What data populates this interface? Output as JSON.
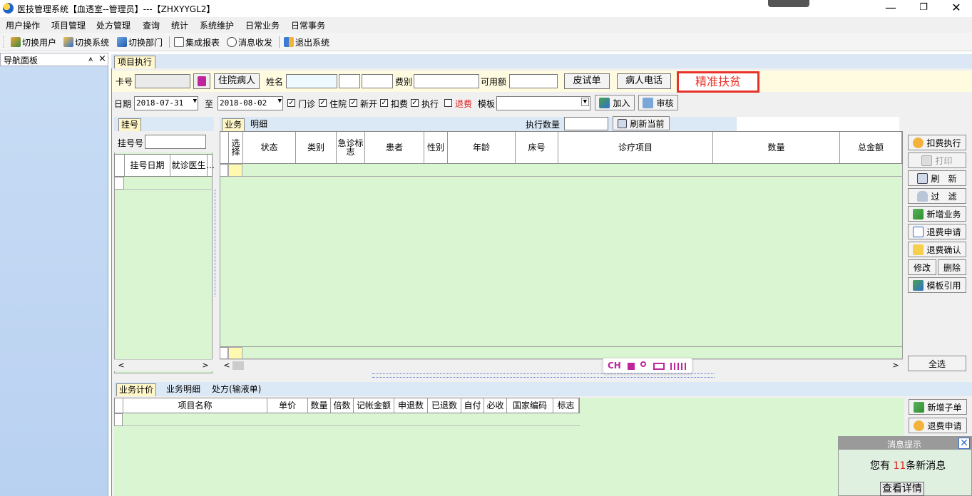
{
  "window": {
    "title": "医技管理系统【血透室--管理员】---【ZHXYYGL2】",
    "minimize": "—",
    "maximize": "❐",
    "close": "✕"
  },
  "menu": [
    "用户操作",
    "项目管理",
    "处方管理",
    "查询",
    "统计",
    "系统维护",
    "日常业务",
    "日常事务"
  ],
  "toolbar": {
    "switch_user": "切换用户",
    "switch_system": "切换系统",
    "switch_dept": "切换部门",
    "report": "集成报表",
    "messages": "消息收发",
    "exit": "退出系统"
  },
  "nav": {
    "title": "导航面板",
    "pin": "⩚",
    "close": "×"
  },
  "doc_tab": "项目执行",
  "form": {
    "card_label": "卡号",
    "inpatient_btn": "住院病人",
    "name_label": "姓名",
    "fee_type_label": "费别",
    "available_label": "可用额",
    "skin_test_btn": "皮试单",
    "phone_btn": "病人电话",
    "poverty_badge": "精准扶贫",
    "date_label": "日期",
    "date_from": "2018-07-31",
    "to_label": "至",
    "date_to": "2018-08-02",
    "chk_outpatient": "门诊",
    "chk_inpatient": "住院",
    "chk_new": "新开",
    "chk_charge": "扣费",
    "chk_execute": "执行",
    "chk_refund": "退费",
    "template_label": "模板",
    "add_btn": "加入",
    "review_btn": "审核"
  },
  "register_panel": {
    "tab": "挂号",
    "reg_no_label": "挂号号",
    "col_date": "挂号日期",
    "col_doctor": "就诊医生",
    "col_more": "…"
  },
  "business_panel": {
    "tabs": [
      "业务",
      "明细"
    ],
    "exec_qty_label": "执行数量",
    "refresh_btn": "刷新当前",
    "columns": [
      "选择",
      "状态",
      "类别",
      "急诊标志",
      "患者",
      "性别",
      "年龄",
      "床号",
      "诊疗项目",
      "数量",
      "总金额"
    ]
  },
  "right_buttons": [
    "扣费执行",
    "打印",
    "刷　新",
    "过　滤",
    "新增业务",
    "退费申请",
    "退费确认",
    "修改",
    "删除",
    "模板引用",
    "全选"
  ],
  "ime_bar": {
    "text": "CH"
  },
  "bottom_panel": {
    "tabs": [
      "业务计价",
      "业务明细",
      "处方(输液单)"
    ],
    "columns": [
      "项目名称",
      "单价",
      "数量",
      "倍数",
      "记帐金额",
      "申退数",
      "已退数",
      "自付",
      "必收",
      "国家编码",
      "标志"
    ],
    "buttons": [
      "新增子单",
      "退费申请"
    ]
  },
  "notification": {
    "title": "消息提示",
    "prefix": "您有",
    "count": "11",
    "suffix": "条新消息",
    "link": "查看详情"
  },
  "colors": {
    "grid_bg": "#d9f5d2",
    "badge_red": "#e8322a",
    "nav_blue": "#c2d8f3"
  }
}
